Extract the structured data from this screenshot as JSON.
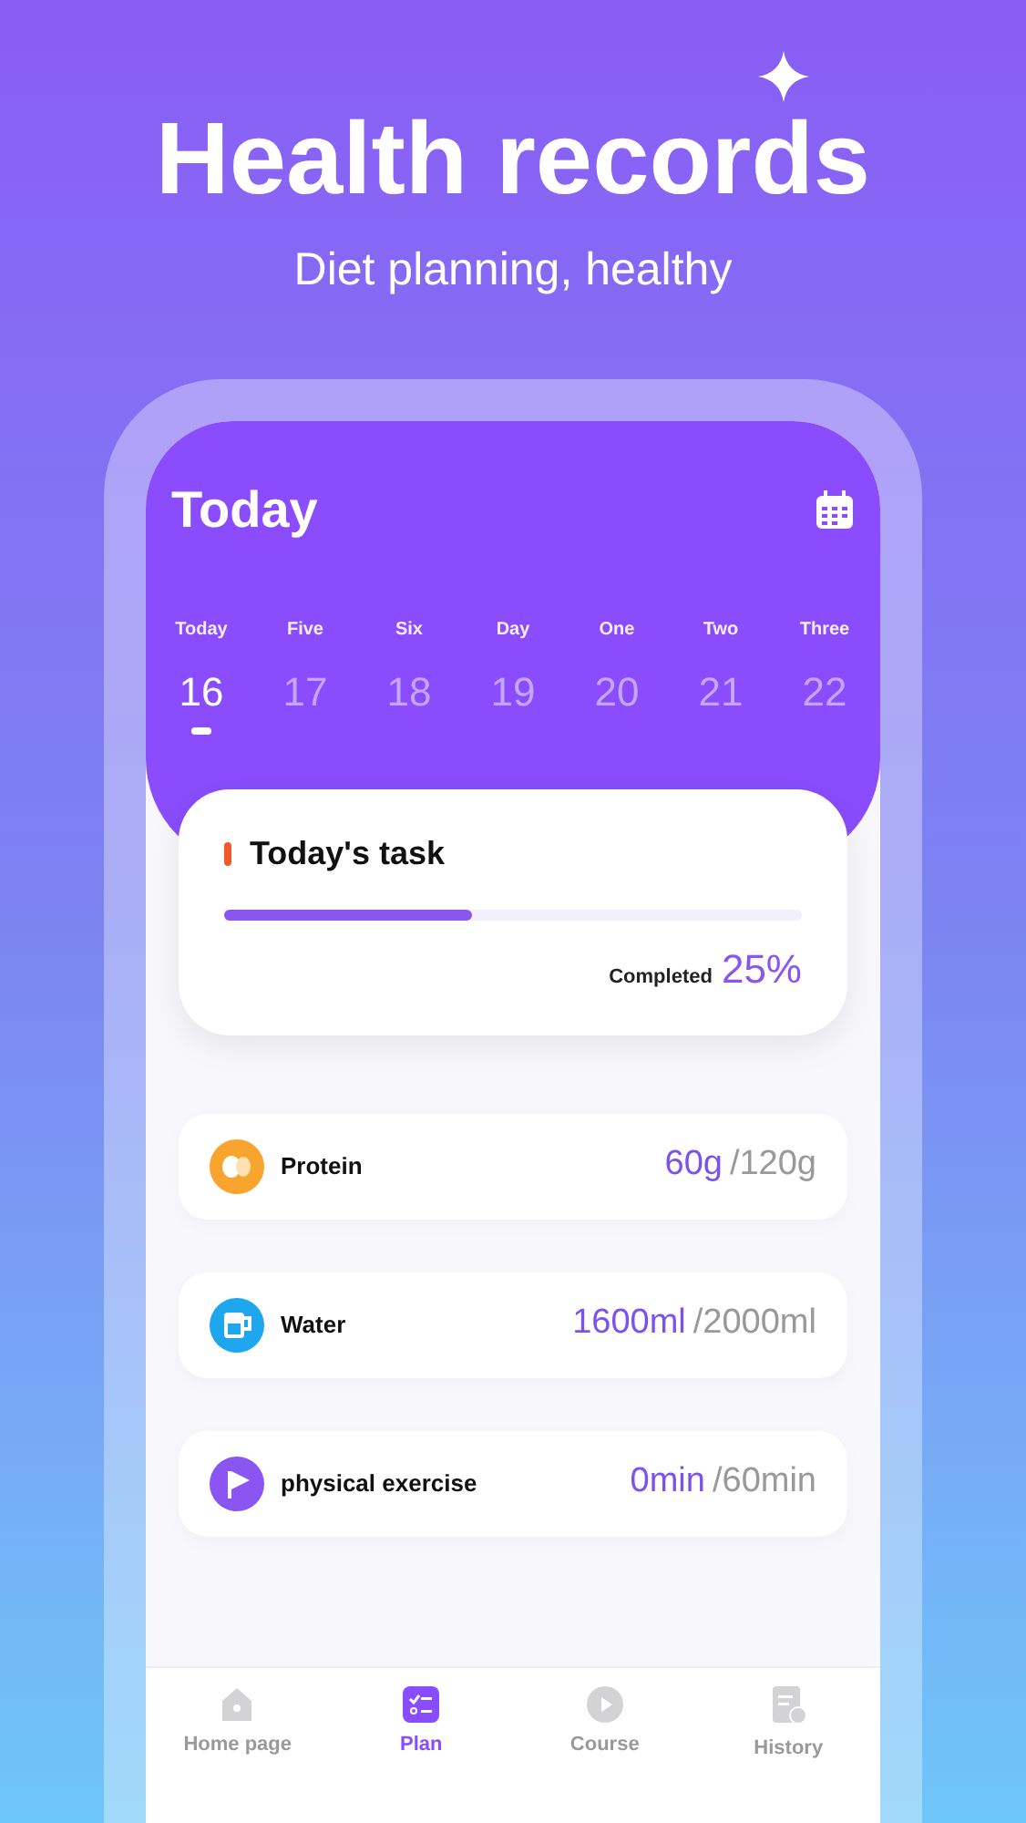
{
  "headline": "Health records",
  "subtitle": "Diet planning, healthy",
  "screen": {
    "title": "Today",
    "days": [
      {
        "label": "Today",
        "date": "16",
        "selected": true
      },
      {
        "label": "Five",
        "date": "17",
        "selected": false
      },
      {
        "label": "Six",
        "date": "18",
        "selected": false
      },
      {
        "label": "Day",
        "date": "19",
        "selected": false
      },
      {
        "label": "One",
        "date": "20",
        "selected": false
      },
      {
        "label": "Two",
        "date": "21",
        "selected": false
      },
      {
        "label": "Three",
        "date": "22",
        "selected": false
      }
    ],
    "task": {
      "title": "Today's task",
      "level": 0.43,
      "completed_label": "Completed",
      "percent": "25%"
    },
    "goals": [
      {
        "kind": "protein",
        "label": "Protein",
        "current": "60g",
        "target": "/120g"
      },
      {
        "kind": "water",
        "label": "Water",
        "current": "1600ml",
        "target": "/2000ml"
      },
      {
        "kind": "exercise",
        "label": "physical exercise",
        "current": "0min",
        "target": "/60min"
      }
    ],
    "nav": [
      {
        "kind": "home",
        "label": "Home page",
        "selected": false
      },
      {
        "kind": "plan",
        "label": "Plan",
        "selected": true
      },
      {
        "kind": "course",
        "label": "Course",
        "selected": false
      },
      {
        "kind": "history",
        "label": "History",
        "selected": false
      }
    ]
  }
}
